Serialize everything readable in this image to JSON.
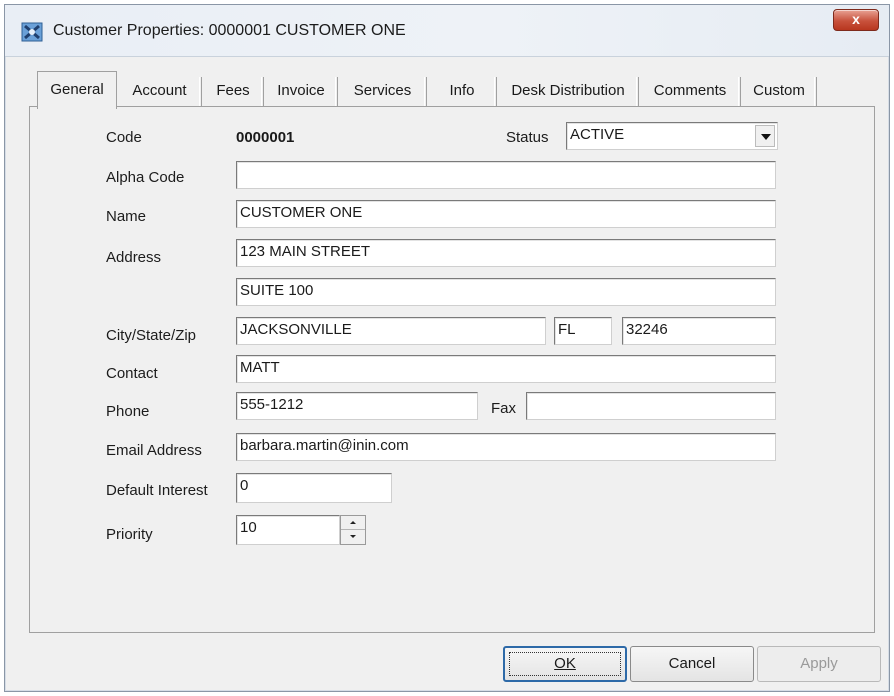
{
  "window": {
    "title": "Customer Properties: 0000001 CUSTOMER ONE",
    "close_label": "x"
  },
  "tabs": [
    {
      "label": "General",
      "active": true
    },
    {
      "label": "Account"
    },
    {
      "label": "Fees"
    },
    {
      "label": "Invoice"
    },
    {
      "label": "Services"
    },
    {
      "label": "Info"
    },
    {
      "label": "Desk Distribution"
    },
    {
      "label": "Comments"
    },
    {
      "label": "Custom"
    }
  ],
  "form": {
    "code_label": "Code",
    "code_value": "0000001",
    "status_label": "Status",
    "status_value": "ACTIVE",
    "alpha_code_label": "Alpha Code",
    "alpha_code_value": "",
    "name_label": "Name",
    "name_value": "CUSTOMER ONE",
    "address_label": "Address",
    "address1_value": "123 MAIN STREET",
    "address2_value": "SUITE 100",
    "city_state_zip_label": "City/State/Zip",
    "city_value": "JACKSONVILLE",
    "state_value": "FL",
    "zip_value": "32246",
    "contact_label": "Contact",
    "contact_value": "MATT",
    "phone_label": "Phone",
    "phone_value": "555-1212",
    "fax_label": "Fax",
    "fax_value": "",
    "email_label": "Email Address",
    "email_value": "barbara.martin@inin.com",
    "default_interest_label": "Default Interest",
    "default_interest_value": "0",
    "priority_label": "Priority",
    "priority_value": "10"
  },
  "buttons": {
    "ok": "OK",
    "cancel": "Cancel",
    "apply": "Apply"
  },
  "colors": {
    "close_button": "#c8513c",
    "default_button_border": "#2e6aa8"
  }
}
